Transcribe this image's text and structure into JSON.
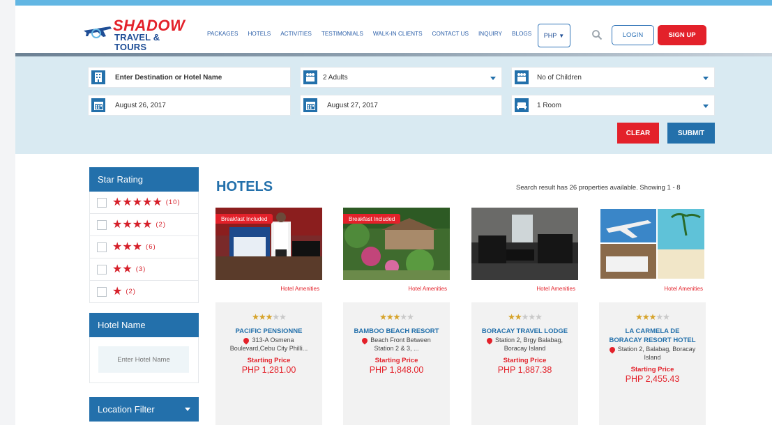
{
  "header": {
    "logo_line1": "SHADOW",
    "logo_line2": "TRAVEL & TOURS",
    "nav": [
      "PACKAGES",
      "HOTELS",
      "ACTIVITIES",
      "TESTIMONIALS",
      "WALK-IN CLIENTS",
      "CONTACT US",
      "INQUIRY",
      "BLOGS"
    ],
    "currency": "PHP",
    "login": "LOGIN",
    "signup": "SIGN UP"
  },
  "search": {
    "destination": "Enter Destination or Hotel Name",
    "adults": "2 Adults",
    "children": "No of Children",
    "checkin": "August 26, 2017",
    "checkout": "August 27, 2017",
    "rooms": "1 Room",
    "clear": "CLEAR",
    "submit": "SUBMIT"
  },
  "sidebar": {
    "star_title": "Star Rating",
    "star_filters": [
      {
        "stars": 5,
        "count": "(10)"
      },
      {
        "stars": 4,
        "count": "(2)"
      },
      {
        "stars": 3,
        "count": "(6)"
      },
      {
        "stars": 2,
        "count": "(3)"
      },
      {
        "stars": 1,
        "count": "(2)"
      }
    ],
    "hotel_name_title": "Hotel Name",
    "hotel_name_placeholder": "Enter Hotel Name",
    "location_title": "Location Filter"
  },
  "main": {
    "title": "HOTELS",
    "result_info": "Search result has 26 properties available. Showing 1 - 8"
  },
  "hotels": [
    {
      "badge": "Breakfast Included",
      "amenities": "Hotel Amenities",
      "stars": 3,
      "name": "PACIFIC PENSIONNE",
      "address": "313-A Osmena Boulevard,Cebu City Philli...",
      "starting": "Starting Price",
      "price": "PHP 1,281.00"
    },
    {
      "badge": "Breakfast Included",
      "amenities": "Hotel Amenities",
      "stars": 3,
      "name": "BAMBOO BEACH RESORT",
      "address": "Beach Front Between Station 2 & 3, ...",
      "starting": "Starting Price",
      "price": "PHP 1,848.00"
    },
    {
      "badge": "",
      "amenities": "Hotel Amenities",
      "stars": 2,
      "name": "BORACAY TRAVEL LODGE",
      "address": "Station 2, Brgy Balabag, Boracay Island",
      "starting": "Starting Price",
      "price": "PHP 1,887.38"
    },
    {
      "badge": "",
      "amenities": "Hotel Amenities",
      "stars": 3,
      "name": "LA CARMELA DE BORACAY RESORT HOTEL",
      "address": "Station 2, Balabag, Boracay Island",
      "starting": "Starting Price",
      "price": "PHP 2,455.43"
    }
  ],
  "colors": {
    "brand_blue": "#2370ab",
    "brand_red": "#e3212a",
    "band": "#d9eaf2"
  }
}
